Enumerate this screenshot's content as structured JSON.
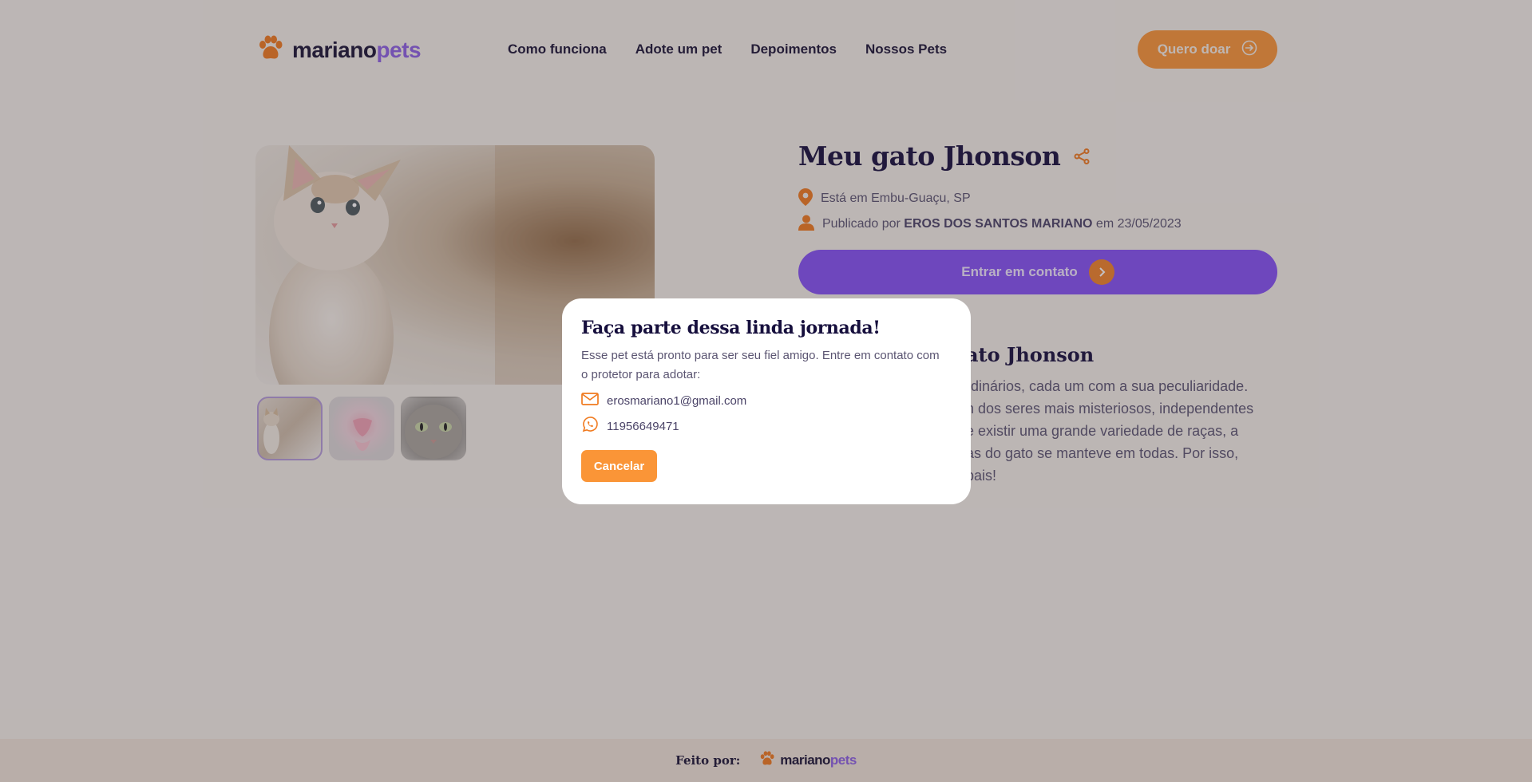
{
  "brand": {
    "name_a": "mariano",
    "name_b": "pets",
    "accent": "#fa9537",
    "purple": "#8451f5"
  },
  "nav": {
    "items": [
      {
        "label": "Como funciona"
      },
      {
        "label": "Adote um pet"
      },
      {
        "label": "Depoimentos"
      },
      {
        "label": "Nossos Pets"
      }
    ]
  },
  "header": {
    "donate_label": "Quero doar",
    "donate_icon": "login-arrow-icon"
  },
  "gallery": {
    "thumbnails": [
      "kitten",
      "pink-nose-kitten",
      "grey-cat"
    ]
  },
  "pet": {
    "title": "Meu gato Jhonson",
    "location": "Está em Embu-Guaçu, SP",
    "published_prefix": "Publicado por",
    "publisher": "EROS DOS SANTOS MARIANO",
    "published_suffix": "em 23/05/2023",
    "contact_label": "Entrar em contato"
  },
  "about": {
    "title_visible": "ato Jhonson",
    "lines": [
      "rdinários, cada um com a sua peculiaridade.",
      "n dos seres mais misteriosos, independentes",
      "e existir uma grande variedade de raças, a",
      "as do gato se manteve em todas. Por isso,",
      "pais!"
    ]
  },
  "modal": {
    "title": "Faça parte dessa linda jornada!",
    "text": "Esse pet está pronto para ser seu fiel amigo. Entre em contato com o protetor para adotar:",
    "email": "erosmariano1@gmail.com",
    "phone": "11956649471",
    "cancel_label": "Cancelar"
  },
  "footer": {
    "label": "Feito por:"
  }
}
